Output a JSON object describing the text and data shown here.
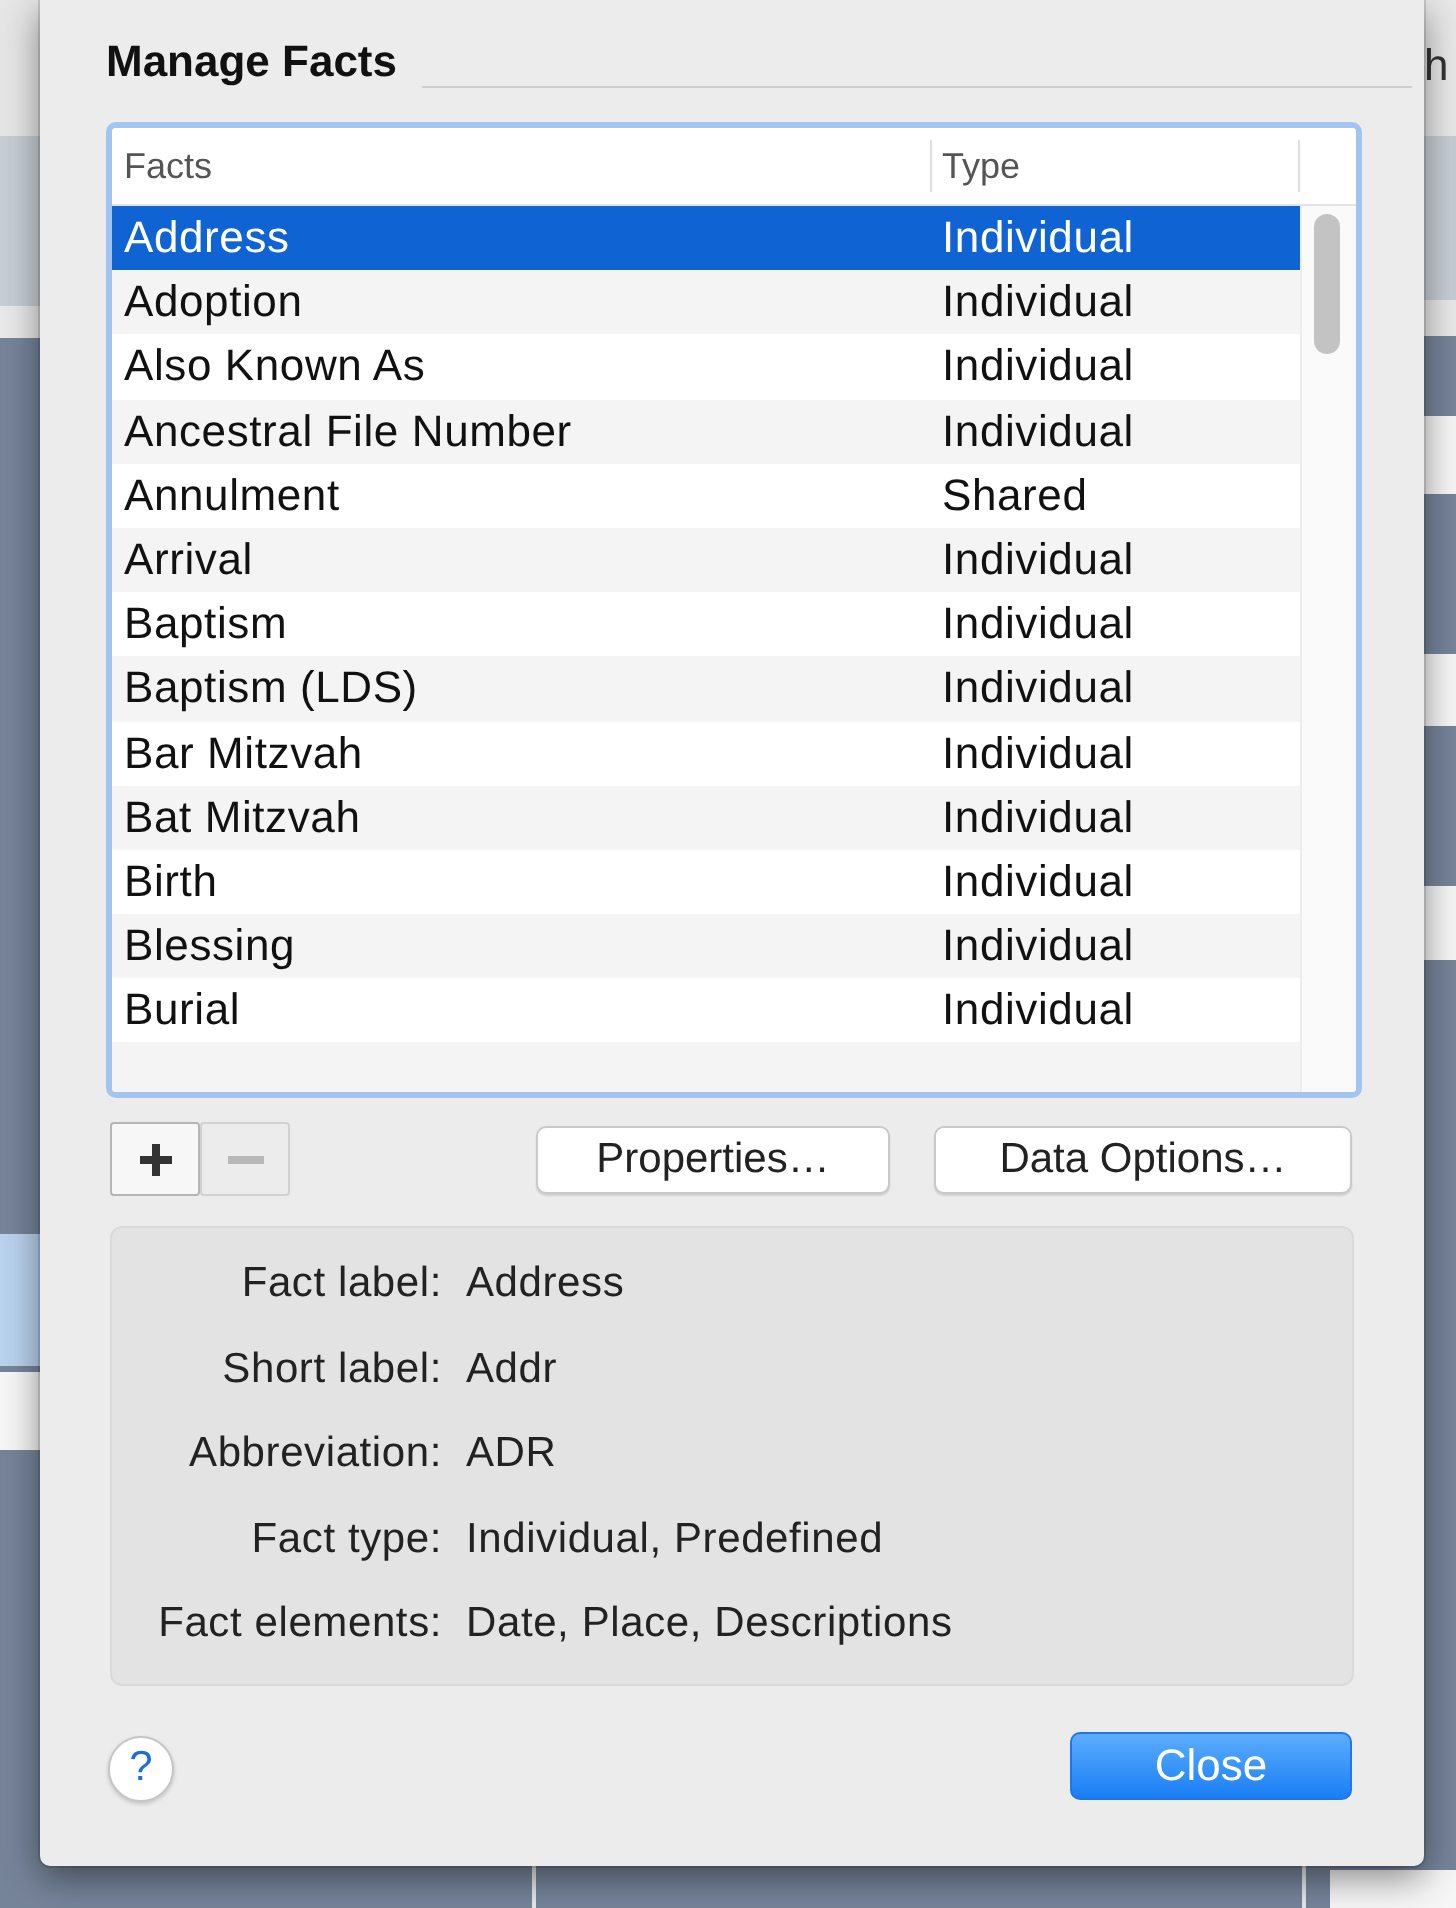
{
  "background": {
    "toolbar_text": "h"
  },
  "dialog": {
    "title": "Manage Facts",
    "table": {
      "columns": [
        "Facts",
        "Type"
      ],
      "rows": [
        {
          "fact": "Address",
          "type": "Individual",
          "selected": true
        },
        {
          "fact": "Adoption",
          "type": "Individual",
          "selected": false
        },
        {
          "fact": "Also Known As",
          "type": "Individual",
          "selected": false
        },
        {
          "fact": "Ancestral File Number",
          "type": "Individual",
          "selected": false
        },
        {
          "fact": "Annulment",
          "type": "Shared",
          "selected": false
        },
        {
          "fact": "Arrival",
          "type": "Individual",
          "selected": false
        },
        {
          "fact": "Baptism",
          "type": "Individual",
          "selected": false
        },
        {
          "fact": "Baptism (LDS)",
          "type": "Individual",
          "selected": false
        },
        {
          "fact": "Bar Mitzvah",
          "type": "Individual",
          "selected": false
        },
        {
          "fact": "Bat Mitzvah",
          "type": "Individual",
          "selected": false
        },
        {
          "fact": "Birth",
          "type": "Individual",
          "selected": false
        },
        {
          "fact": "Blessing",
          "type": "Individual",
          "selected": false
        },
        {
          "fact": "Burial",
          "type": "Individual",
          "selected": false
        }
      ]
    },
    "list_buttons": [
      {
        "kind": "add",
        "disabled": false
      },
      {
        "kind": "remove",
        "disabled": true
      }
    ],
    "buttons": [
      "Properties…",
      "Data Options…"
    ],
    "details": [
      {
        "label": "Fact label:",
        "value": "Address"
      },
      {
        "label": "Short label:",
        "value": "Addr"
      },
      {
        "label": "Abbreviation:",
        "value": "ADR"
      },
      {
        "label": "Fact type:",
        "value": "Individual, Predefined"
      },
      {
        "label": "Fact elements:",
        "value": "Date, Place, Descriptions"
      }
    ],
    "help_button": "?",
    "close_button": "Close"
  }
}
